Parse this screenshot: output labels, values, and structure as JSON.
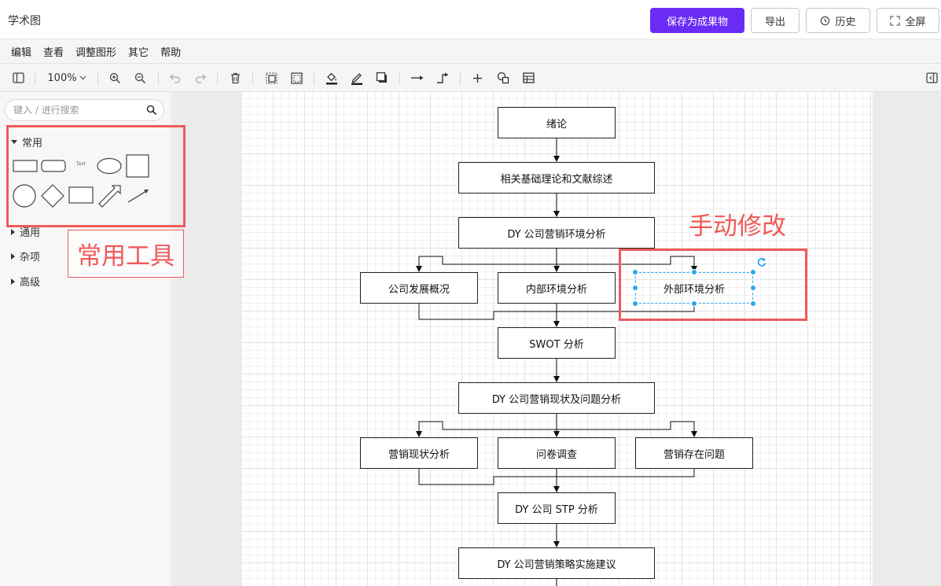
{
  "header": {
    "title": "学术图",
    "save_button": "保存为成果物",
    "export_button": "导出",
    "history_button": "历史",
    "fullscreen_button": "全屏"
  },
  "menu": [
    "编辑",
    "查看",
    "调整图形",
    "其它",
    "帮助"
  ],
  "toolbar": {
    "zoom": "100%"
  },
  "sidebar": {
    "search_placeholder": "键入 / 进行搜索",
    "sections": {
      "common": "常用",
      "general": "通用",
      "misc": "杂项",
      "advanced": "高级"
    },
    "text_shape_label": "Text"
  },
  "annotations": {
    "tools_label": "常用工具",
    "manual_edit": "手动修改"
  },
  "diagram": {
    "nodes": {
      "n1": "绪论",
      "n2": "相关基础理论和文献综述",
      "n3": "DY 公司营销环境分析",
      "n4a": "公司发展概况",
      "n4b": "内部环境分析",
      "n4c": "外部环境分析",
      "n5": "SWOT 分析",
      "n6": "DY 公司营销现状及问题分析",
      "n7a": "营销现状分析",
      "n7b": "问卷调查",
      "n7c": "营销存在问题",
      "n8": "DY 公司 STP 分析",
      "n9": "DY 公司营销策略实施建议"
    }
  },
  "colors": {
    "primary": "#6a2cf5",
    "annotation": "#f05a5a",
    "selection": "#29a6f2"
  }
}
